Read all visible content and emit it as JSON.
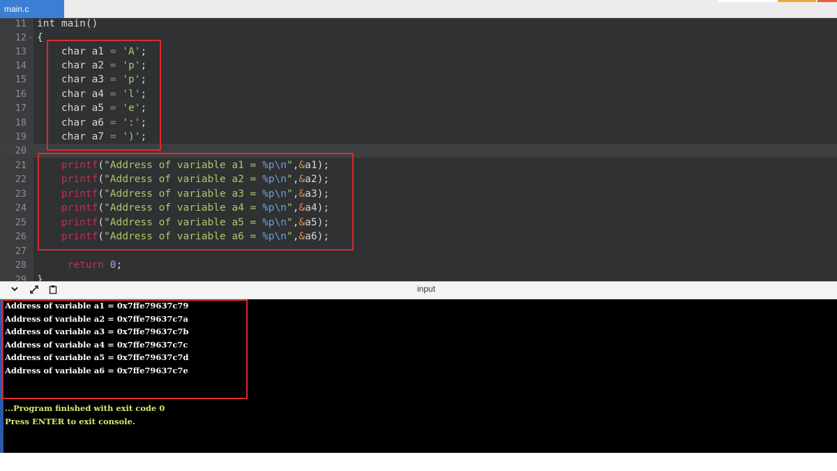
{
  "tab": {
    "label": "main.c"
  },
  "editor": {
    "lines": [
      {
        "num": "11",
        "fold": "",
        "tokens": [
          {
            "t": "int main()",
            "c": "kw"
          }
        ]
      },
      {
        "num": "12",
        "fold": "-",
        "tokens": [
          {
            "t": "{",
            "c": "kw"
          }
        ]
      },
      {
        "num": "13",
        "fold": "",
        "tokens": [
          {
            "t": "    char a1 ",
            "c": "kw"
          },
          {
            "t": "=",
            "c": "op"
          },
          {
            "t": " ",
            "c": "kw"
          },
          {
            "t": "'A'",
            "c": "str"
          },
          {
            "t": ";",
            "c": "kw"
          }
        ]
      },
      {
        "num": "14",
        "fold": "",
        "tokens": [
          {
            "t": "    char a2 ",
            "c": "kw"
          },
          {
            "t": "=",
            "c": "op"
          },
          {
            "t": " ",
            "c": "kw"
          },
          {
            "t": "'p'",
            "c": "str"
          },
          {
            "t": ";",
            "c": "kw"
          }
        ]
      },
      {
        "num": "15",
        "fold": "",
        "tokens": [
          {
            "t": "    char a3 ",
            "c": "kw"
          },
          {
            "t": "=",
            "c": "op"
          },
          {
            "t": " ",
            "c": "kw"
          },
          {
            "t": "'p'",
            "c": "str"
          },
          {
            "t": ";",
            "c": "kw"
          }
        ]
      },
      {
        "num": "16",
        "fold": "",
        "tokens": [
          {
            "t": "    char a4 ",
            "c": "kw"
          },
          {
            "t": "=",
            "c": "op"
          },
          {
            "t": " ",
            "c": "kw"
          },
          {
            "t": "'l'",
            "c": "str"
          },
          {
            "t": ";",
            "c": "kw"
          }
        ]
      },
      {
        "num": "17",
        "fold": "",
        "tokens": [
          {
            "t": "    char a5 ",
            "c": "kw"
          },
          {
            "t": "=",
            "c": "op"
          },
          {
            "t": " ",
            "c": "kw"
          },
          {
            "t": "'e'",
            "c": "str"
          },
          {
            "t": ";",
            "c": "kw"
          }
        ]
      },
      {
        "num": "18",
        "fold": "",
        "tokens": [
          {
            "t": "    char a6 ",
            "c": "kw"
          },
          {
            "t": "=",
            "c": "op"
          },
          {
            "t": " ",
            "c": "kw"
          },
          {
            "t": "':'",
            "c": "str"
          },
          {
            "t": ";",
            "c": "kw"
          }
        ]
      },
      {
        "num": "19",
        "fold": "",
        "tokens": [
          {
            "t": "    char a7 ",
            "c": "kw"
          },
          {
            "t": "=",
            "c": "op"
          },
          {
            "t": " ",
            "c": "kw"
          },
          {
            "t": "')'",
            "c": "str"
          },
          {
            "t": ";",
            "c": "kw"
          }
        ]
      },
      {
        "num": "20",
        "fold": "",
        "active": true,
        "tokens": []
      },
      {
        "num": "21",
        "fold": "",
        "tokens": [
          {
            "t": "    ",
            "c": "kw"
          },
          {
            "t": "printf",
            "c": "fn"
          },
          {
            "t": "(",
            "c": "kw"
          },
          {
            "t": "\"Address of variable a1 = ",
            "c": "str"
          },
          {
            "t": "%p\\n",
            "c": "fmt"
          },
          {
            "t": "\"",
            "c": "str"
          },
          {
            "t": ",",
            "c": "kw"
          },
          {
            "t": "&",
            "c": "amp"
          },
          {
            "t": "a1);",
            "c": "kw"
          }
        ]
      },
      {
        "num": "22",
        "fold": "",
        "tokens": [
          {
            "t": "    ",
            "c": "kw"
          },
          {
            "t": "printf",
            "c": "fn"
          },
          {
            "t": "(",
            "c": "kw"
          },
          {
            "t": "\"Address of variable a2 = ",
            "c": "str"
          },
          {
            "t": "%p\\n",
            "c": "fmt"
          },
          {
            "t": "\"",
            "c": "str"
          },
          {
            "t": ",",
            "c": "kw"
          },
          {
            "t": "&",
            "c": "amp"
          },
          {
            "t": "a2);",
            "c": "kw"
          }
        ]
      },
      {
        "num": "23",
        "fold": "",
        "tokens": [
          {
            "t": "    ",
            "c": "kw"
          },
          {
            "t": "printf",
            "c": "fn"
          },
          {
            "t": "(",
            "c": "kw"
          },
          {
            "t": "\"Address of variable a3 = ",
            "c": "str"
          },
          {
            "t": "%p\\n",
            "c": "fmt"
          },
          {
            "t": "\"",
            "c": "str"
          },
          {
            "t": ",",
            "c": "kw"
          },
          {
            "t": "&",
            "c": "amp"
          },
          {
            "t": "a3);",
            "c": "kw"
          }
        ]
      },
      {
        "num": "24",
        "fold": "",
        "tokens": [
          {
            "t": "    ",
            "c": "kw"
          },
          {
            "t": "printf",
            "c": "fn"
          },
          {
            "t": "(",
            "c": "kw"
          },
          {
            "t": "\"Address of variable a4 = ",
            "c": "str"
          },
          {
            "t": "%p\\n",
            "c": "fmt"
          },
          {
            "t": "\"",
            "c": "str"
          },
          {
            "t": ",",
            "c": "kw"
          },
          {
            "t": "&",
            "c": "amp"
          },
          {
            "t": "a4);",
            "c": "kw"
          }
        ]
      },
      {
        "num": "25",
        "fold": "",
        "tokens": [
          {
            "t": "    ",
            "c": "kw"
          },
          {
            "t": "printf",
            "c": "fn"
          },
          {
            "t": "(",
            "c": "kw"
          },
          {
            "t": "\"Address of variable a5 = ",
            "c": "str"
          },
          {
            "t": "%p\\n",
            "c": "fmt"
          },
          {
            "t": "\"",
            "c": "str"
          },
          {
            "t": ",",
            "c": "kw"
          },
          {
            "t": "&",
            "c": "amp"
          },
          {
            "t": "a5);",
            "c": "kw"
          }
        ]
      },
      {
        "num": "26",
        "fold": "",
        "tokens": [
          {
            "t": "    ",
            "c": "kw"
          },
          {
            "t": "printf",
            "c": "fn"
          },
          {
            "t": "(",
            "c": "kw"
          },
          {
            "t": "\"Address of variable a6 = ",
            "c": "str"
          },
          {
            "t": "%p\\n",
            "c": "fmt"
          },
          {
            "t": "\"",
            "c": "str"
          },
          {
            "t": ",",
            "c": "kw"
          },
          {
            "t": "&",
            "c": "amp"
          },
          {
            "t": "a6);",
            "c": "kw"
          }
        ]
      },
      {
        "num": "27",
        "fold": "",
        "tokens": []
      },
      {
        "num": "28",
        "fold": "",
        "tokens": [
          {
            "t": "     ",
            "c": "kw"
          },
          {
            "t": "return",
            "c": "ret"
          },
          {
            "t": " ",
            "c": "kw"
          },
          {
            "t": "0",
            "c": "num"
          },
          {
            "t": ";",
            "c": "kw"
          }
        ]
      },
      {
        "num": "29",
        "fold": "",
        "tokens": [
          {
            "t": "}",
            "c": "kw"
          }
        ]
      }
    ]
  },
  "io_panel": {
    "label": "input",
    "collapse_icon": "chevron-down-icon",
    "expand_icon": "expand-arrows-icon",
    "copy_icon": "clipboard-icon"
  },
  "console": {
    "output": [
      "Address of variable a1 = 0x7ffe79637c79",
      "Address of variable a2 = 0x7ffe79637c7a",
      "Address of variable a3 = 0x7ffe79637c7b",
      "Address of variable a4 = 0x7ffe79637c7c",
      "Address of variable a5 = 0x7ffe79637c7d",
      "Address of variable a6 = 0x7ffe79637c7e"
    ],
    "messages": [
      "...Program finished with exit code 0",
      "Press ENTER to exit console."
    ]
  },
  "colors": {
    "editor_bg": "#2f3133",
    "highlight_box": "#e02a2a",
    "tab_active": "#3b7fd4",
    "console_bg": "#000000",
    "console_message": "#d9e86a"
  }
}
